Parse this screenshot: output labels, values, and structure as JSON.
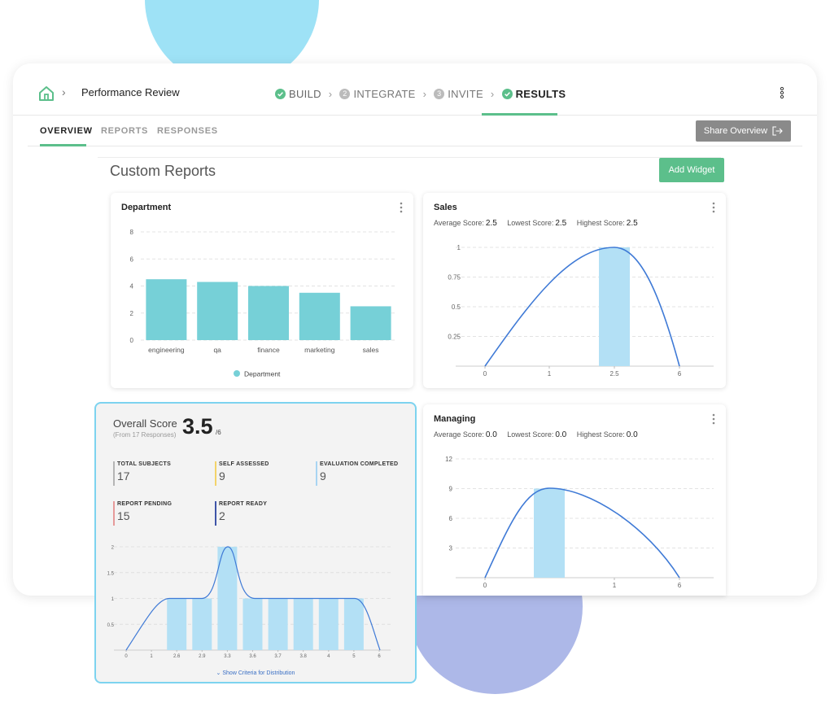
{
  "header": {
    "breadcrumb_title": "Performance Review",
    "steps": [
      {
        "label": "BUILD",
        "state": "done",
        "num": ""
      },
      {
        "label": "INTEGRATE",
        "state": "pending",
        "num": "2"
      },
      {
        "label": "INVITE",
        "state": "pending",
        "num": "3"
      },
      {
        "label": "RESULTS",
        "state": "active",
        "num": ""
      }
    ]
  },
  "tabs": {
    "overview": "OVERVIEW",
    "reports": "REPORTS",
    "responses": "RESPONSES"
  },
  "share_button": "Share Overview",
  "section_title": "Custom Reports",
  "add_widget_button": "Add Widget",
  "colors": {
    "accent": "#5cbf8b",
    "bar_teal": "#76d0d7",
    "bar_light": "#b3e0f5",
    "curve": "#3f7ad6",
    "frame": "#7dd3ef"
  },
  "department": {
    "title": "Department",
    "legend": "Department",
    "chart_data": {
      "type": "bar",
      "categories": [
        "engineering",
        "qa",
        "finance",
        "marketing",
        "sales"
      ],
      "values": [
        4.5,
        4.3,
        4.0,
        3.5,
        2.5
      ],
      "ylim": [
        0,
        8
      ],
      "yticks": [
        "0",
        "2",
        "4",
        "6",
        "8"
      ],
      "legend": [
        "Department"
      ],
      "legend_position": "bottom",
      "grid": true
    }
  },
  "sales": {
    "title": "Sales",
    "avg_label": "Average Score:",
    "avg_value": "2.5",
    "low_label": "Lowest Score:",
    "low_value": "2.5",
    "high_label": "Highest Score:",
    "high_value": "2.5",
    "chart_data": {
      "type": "bar",
      "x_ticks": [
        "0",
        "1",
        "2.5",
        "6"
      ],
      "y_ticks": [
        "0.25",
        "0.5",
        "0.75",
        "1"
      ],
      "categories": [
        "2.5"
      ],
      "values": [
        1
      ],
      "curve": "bell curve peaking at 1 over 2.5",
      "ylim": [
        0,
        1
      ],
      "grid": true
    }
  },
  "managing": {
    "title": "Managing",
    "avg_label": "Average Score:",
    "avg_value": "0.0",
    "low_label": "Lowest Score:",
    "low_value": "0.0",
    "high_label": "Highest Score:",
    "high_value": "0.0",
    "chart_data": {
      "type": "bar",
      "x_ticks": [
        "0",
        "1",
        "6"
      ],
      "y_ticks": [
        "3",
        "6",
        "9",
        "12"
      ],
      "categories": [
        "0"
      ],
      "values": [
        9
      ],
      "curve": "curve peaking at 9",
      "ylim": [
        0,
        12
      ],
      "grid": true
    }
  },
  "overall": {
    "label": "Overall Score",
    "sub": "(From 17 Responses)",
    "score": "3.5",
    "denominator": "/6",
    "metrics": [
      {
        "label": "TOTAL SUBJECTS",
        "value": "17",
        "color": "#b5b5b5"
      },
      {
        "label": "SELF ASSESSED",
        "value": "9",
        "color": "#f3d36a"
      },
      {
        "label": "EVALUATION COMPLETED",
        "value": "9",
        "color": "#a8d4f2"
      },
      {
        "label": "REPORT PENDING",
        "value": "15",
        "color": "#e69a9a"
      },
      {
        "label": "REPORT READY",
        "value": "2",
        "color": "#3f55a8"
      }
    ],
    "show_criteria": "Show Criteria for Distribution",
    "chart_data": {
      "type": "bar",
      "categories": [
        "2.6",
        "2.9",
        "3.3",
        "3.6",
        "3.7",
        "3.8",
        "4",
        "5"
      ],
      "values": [
        1,
        1,
        2,
        1,
        1,
        1,
        1,
        1
      ],
      "x_ticks": [
        "0",
        "1",
        "2.6",
        "2.9",
        "3.3",
        "3.6",
        "3.7",
        "3.8",
        "4",
        "5",
        "6"
      ],
      "y_ticks": [
        "0.5",
        "1",
        "1.5",
        "2"
      ],
      "ylim": [
        0,
        2
      ],
      "grid": true
    }
  }
}
